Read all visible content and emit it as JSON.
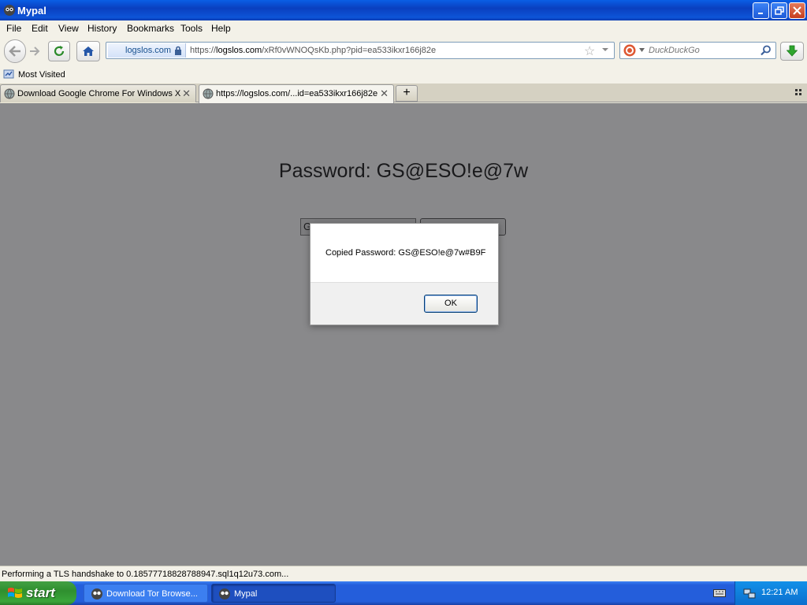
{
  "window": {
    "title": "Mypal"
  },
  "menu": [
    "File",
    "Edit",
    "View",
    "History",
    "Bookmarks",
    "Tools",
    "Help"
  ],
  "menu_mnemonics": [
    "F",
    "E",
    "V",
    "H",
    "B",
    "T",
    "H"
  ],
  "urlbar": {
    "identity_host": "logslos.com",
    "prefix": "https://",
    "domain": "logslos.com",
    "path": "/xRf0vWNOQsKb.php?pid=ea533ikxr166j82e"
  },
  "search": {
    "placeholder": "DuckDuckGo"
  },
  "bookmarks": {
    "most_visited": "Most Visited"
  },
  "tabs": [
    {
      "label": "Download Google Chrome For Windows X...",
      "active": false
    },
    {
      "label": "https://logslos.com/...id=ea533ikxr166j82e",
      "active": true
    }
  ],
  "page": {
    "heading": "Password: GS@ESO!e@7w",
    "input_value": "G"
  },
  "dialog": {
    "message": "Copied Password: GS@ESO!e@7w#B9F",
    "ok_label": "OK"
  },
  "status": {
    "text": "Performing a TLS handshake to 0.18577718828788947.sql1q12u73.com..."
  },
  "taskbar": {
    "start_label": "start",
    "items": [
      {
        "label": "Download Tor Browse...",
        "active": false
      },
      {
        "label": "Mypal",
        "active": true
      }
    ],
    "clock": "12:21 AM"
  },
  "colors": {
    "titlebar": "#0a3fbf",
    "taskbar": "#245edb",
    "start": "#2f8f2f",
    "overlay": "#7a7a7e"
  }
}
